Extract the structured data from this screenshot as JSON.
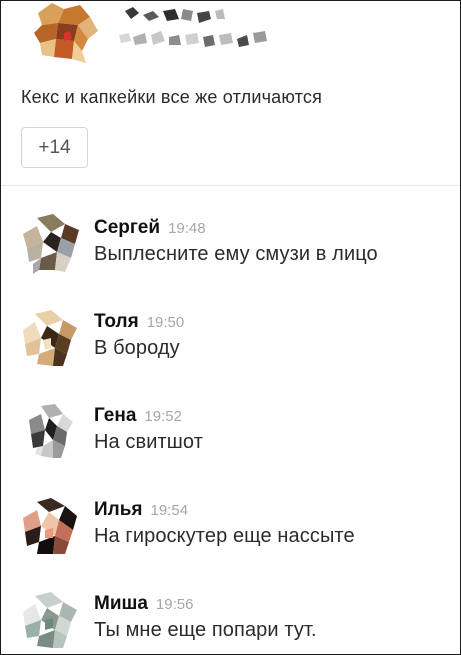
{
  "post": {
    "text": "Кекс и капкейки все же отличаются",
    "more_button": "+14"
  },
  "comments": [
    {
      "name": "Сергей",
      "time": "19:48",
      "text": "Выплесните ему смузи в лицо"
    },
    {
      "name": "Толя",
      "time": "19:50",
      "text": "В бороду"
    },
    {
      "name": "Гена",
      "time": "19:52",
      "text": "На свитшот"
    },
    {
      "name": "Илья",
      "time": "19:54",
      "text": "На гироскутер еще нассыте"
    },
    {
      "name": "Миша",
      "time": "19:56",
      "text": "Ты мне еще попари тут."
    }
  ],
  "colors": {
    "name": "#111111",
    "time": "#a6a6a6",
    "text": "#2b2b2b",
    "divider": "#e6e6e6",
    "button_border": "#d5d5d5"
  }
}
